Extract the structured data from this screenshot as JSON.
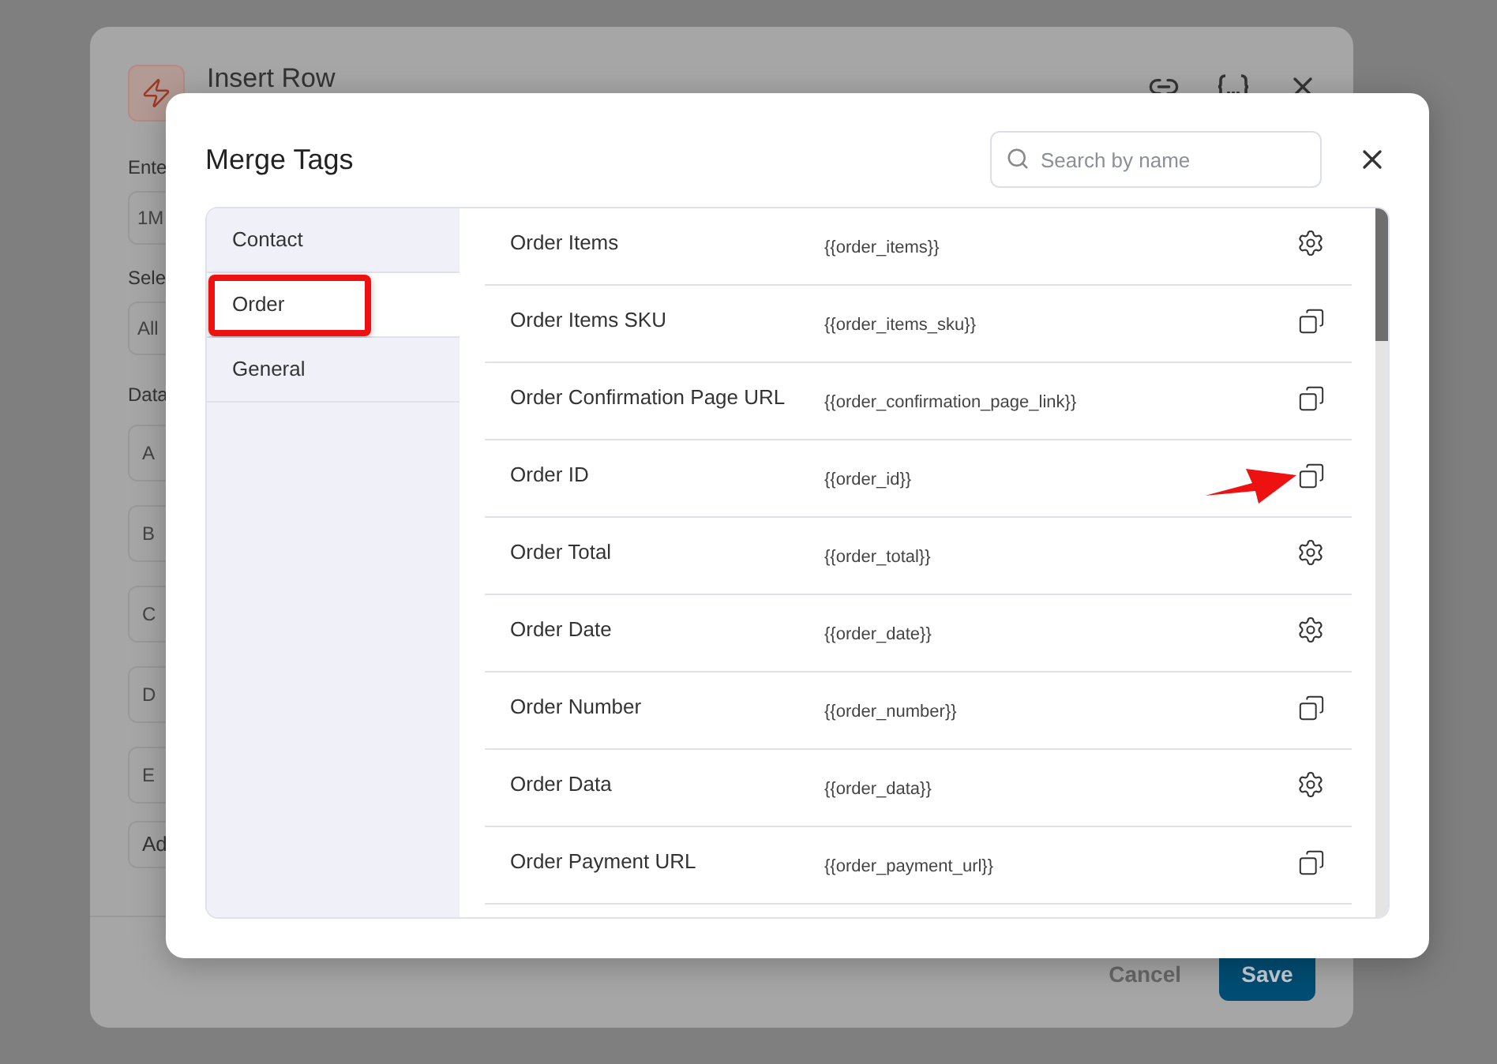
{
  "background_dialog": {
    "title": "Insert Row",
    "fields": [
      {
        "label": "Ente",
        "value": "1M"
      },
      {
        "label": "Sele",
        "value": "All"
      }
    ],
    "data_label": "Data",
    "columns": [
      "A",
      "B",
      "C",
      "D",
      "E"
    ],
    "add_button": "Ad",
    "footer": {
      "cancel": "Cancel",
      "save": "Save"
    }
  },
  "modal": {
    "title": "Merge Tags",
    "search": {
      "placeholder": "Search by name"
    },
    "categories": [
      {
        "label": "Contact",
        "selected": false
      },
      {
        "label": "Order",
        "selected": true
      },
      {
        "label": "General",
        "selected": false
      }
    ],
    "tags": [
      {
        "name": "Order Items",
        "tag": "{{order_items}}",
        "kind": "settings"
      },
      {
        "name": "Order Items SKU",
        "tag": "{{order_items_sku}}",
        "kind": "copy"
      },
      {
        "name": "Order Confirmation Page URL",
        "tag": "{{order_confirmation_page_link}}",
        "kind": "copy"
      },
      {
        "name": "Order ID",
        "tag": "{{order_id}}",
        "kind": "copy"
      },
      {
        "name": "Order Total",
        "tag": "{{order_total}}",
        "kind": "settings"
      },
      {
        "name": "Order Date",
        "tag": "{{order_date}}",
        "kind": "settings"
      },
      {
        "name": "Order Number",
        "tag": "{{order_number}}",
        "kind": "copy"
      },
      {
        "name": "Order Data",
        "tag": "{{order_data}}",
        "kind": "settings"
      },
      {
        "name": "Order Payment URL",
        "tag": "{{order_payment_url}}",
        "kind": "copy"
      }
    ]
  }
}
